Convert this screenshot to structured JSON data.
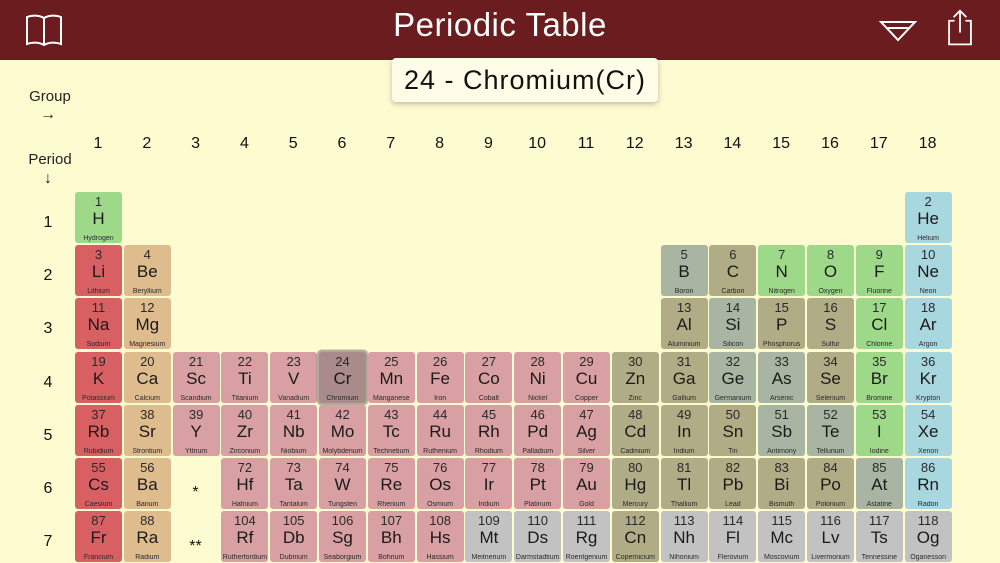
{
  "header": {
    "title": "Periodic Table"
  },
  "selected": {
    "label": "24 - Chromium(Cr)"
  },
  "axis": {
    "group_label": "Group",
    "period_label": "Period",
    "group_arrow": "→",
    "period_arrow": "↓"
  },
  "groups": [
    "1",
    "2",
    "3",
    "4",
    "5",
    "6",
    "7",
    "8",
    "9",
    "10",
    "11",
    "12",
    "13",
    "14",
    "15",
    "16",
    "17",
    "18"
  ],
  "periods": [
    "1",
    "2",
    "3",
    "4",
    "5",
    "6",
    "7"
  ],
  "markers": {
    "lanthanides": "*",
    "actinides": "**"
  },
  "colors": {
    "alkali": "#d86063",
    "alkaline": "#dfbc8e",
    "transition": "#d9a0a3",
    "post": "#b0ac85",
    "metalloid": "#a8b5a3",
    "nonmetal": "#9ed98a",
    "noble": "#a9d7e0",
    "unknown": "#c2c2c2",
    "header": "#6b1c1f",
    "background": "#fdfbd0"
  },
  "elements": [
    {
      "n": "1",
      "s": "H",
      "name": "Hydrogen",
      "g": 1,
      "p": 1,
      "c": "nonmetal"
    },
    {
      "n": "2",
      "s": "He",
      "name": "Helium",
      "g": 18,
      "p": 1,
      "c": "noble"
    },
    {
      "n": "3",
      "s": "Li",
      "name": "Lithium",
      "g": 1,
      "p": 2,
      "c": "alkali"
    },
    {
      "n": "4",
      "s": "Be",
      "name": "Beryllium",
      "g": 2,
      "p": 2,
      "c": "alkaline"
    },
    {
      "n": "5",
      "s": "B",
      "name": "Boron",
      "g": 13,
      "p": 2,
      "c": "metalloid"
    },
    {
      "n": "6",
      "s": "C",
      "name": "Carbon",
      "g": 14,
      "p": 2,
      "c": "post"
    },
    {
      "n": "7",
      "s": "N",
      "name": "Nitrogen",
      "g": 15,
      "p": 2,
      "c": "nonmetal"
    },
    {
      "n": "8",
      "s": "O",
      "name": "Oxygen",
      "g": 16,
      "p": 2,
      "c": "nonmetal"
    },
    {
      "n": "9",
      "s": "F",
      "name": "Fluorine",
      "g": 17,
      "p": 2,
      "c": "nonmetal"
    },
    {
      "n": "10",
      "s": "Ne",
      "name": "Neon",
      "g": 18,
      "p": 2,
      "c": "noble"
    },
    {
      "n": "11",
      "s": "Na",
      "name": "Sodium",
      "g": 1,
      "p": 3,
      "c": "alkali"
    },
    {
      "n": "12",
      "s": "Mg",
      "name": "Magnesium",
      "g": 2,
      "p": 3,
      "c": "alkaline"
    },
    {
      "n": "13",
      "s": "Al",
      "name": "Aluminium",
      "g": 13,
      "p": 3,
      "c": "post"
    },
    {
      "n": "14",
      "s": "Si",
      "name": "Silicon",
      "g": 14,
      "p": 3,
      "c": "metalloid"
    },
    {
      "n": "15",
      "s": "P",
      "name": "Phosphorus",
      "g": 15,
      "p": 3,
      "c": "post"
    },
    {
      "n": "16",
      "s": "S",
      "name": "Sulfur",
      "g": 16,
      "p": 3,
      "c": "post"
    },
    {
      "n": "17",
      "s": "Cl",
      "name": "Chlorine",
      "g": 17,
      "p": 3,
      "c": "nonmetal"
    },
    {
      "n": "18",
      "s": "Ar",
      "name": "Argon",
      "g": 18,
      "p": 3,
      "c": "noble"
    },
    {
      "n": "19",
      "s": "K",
      "name": "Potassium",
      "g": 1,
      "p": 4,
      "c": "alkali"
    },
    {
      "n": "20",
      "s": "Ca",
      "name": "Calcium",
      "g": 2,
      "p": 4,
      "c": "alkaline"
    },
    {
      "n": "21",
      "s": "Sc",
      "name": "Scandium",
      "g": 3,
      "p": 4,
      "c": "transition"
    },
    {
      "n": "22",
      "s": "Ti",
      "name": "Titanium",
      "g": 4,
      "p": 4,
      "c": "transition"
    },
    {
      "n": "23",
      "s": "V",
      "name": "Vanadium",
      "g": 5,
      "p": 4,
      "c": "transition"
    },
    {
      "n": "24",
      "s": "Cr",
      "name": "Chromium",
      "g": 6,
      "p": 4,
      "c": "transition",
      "selected": true
    },
    {
      "n": "25",
      "s": "Mn",
      "name": "Manganese",
      "g": 7,
      "p": 4,
      "c": "transition"
    },
    {
      "n": "26",
      "s": "Fe",
      "name": "Iron",
      "g": 8,
      "p": 4,
      "c": "transition"
    },
    {
      "n": "27",
      "s": "Co",
      "name": "Cobalt",
      "g": 9,
      "p": 4,
      "c": "transition"
    },
    {
      "n": "28",
      "s": "Ni",
      "name": "Nickel",
      "g": 10,
      "p": 4,
      "c": "transition"
    },
    {
      "n": "29",
      "s": "Cu",
      "name": "Copper",
      "g": 11,
      "p": 4,
      "c": "transition"
    },
    {
      "n": "30",
      "s": "Zn",
      "name": "Zinc",
      "g": 12,
      "p": 4,
      "c": "post"
    },
    {
      "n": "31",
      "s": "Ga",
      "name": "Gallium",
      "g": 13,
      "p": 4,
      "c": "post"
    },
    {
      "n": "32",
      "s": "Ge",
      "name": "Germanium",
      "g": 14,
      "p": 4,
      "c": "metalloid"
    },
    {
      "n": "33",
      "s": "As",
      "name": "Arsenic",
      "g": 15,
      "p": 4,
      "c": "metalloid"
    },
    {
      "n": "34",
      "s": "Se",
      "name": "Selenium",
      "g": 16,
      "p": 4,
      "c": "post"
    },
    {
      "n": "35",
      "s": "Br",
      "name": "Bromine",
      "g": 17,
      "p": 4,
      "c": "nonmetal"
    },
    {
      "n": "36",
      "s": "Kr",
      "name": "Krypton",
      "g": 18,
      "p": 4,
      "c": "noble"
    },
    {
      "n": "37",
      "s": "Rb",
      "name": "Rubidium",
      "g": 1,
      "p": 5,
      "c": "alkali"
    },
    {
      "n": "38",
      "s": "Sr",
      "name": "Strontium",
      "g": 2,
      "p": 5,
      "c": "alkaline"
    },
    {
      "n": "39",
      "s": "Y",
      "name": "Yttrium",
      "g": 3,
      "p": 5,
      "c": "transition"
    },
    {
      "n": "40",
      "s": "Zr",
      "name": "Zirconium",
      "g": 4,
      "p": 5,
      "c": "transition"
    },
    {
      "n": "41",
      "s": "Nb",
      "name": "Niobium",
      "g": 5,
      "p": 5,
      "c": "transition"
    },
    {
      "n": "42",
      "s": "Mo",
      "name": "Molybdenum",
      "g": 6,
      "p": 5,
      "c": "transition"
    },
    {
      "n": "43",
      "s": "Tc",
      "name": "Technetium",
      "g": 7,
      "p": 5,
      "c": "transition"
    },
    {
      "n": "44",
      "s": "Ru",
      "name": "Ruthenium",
      "g": 8,
      "p": 5,
      "c": "transition"
    },
    {
      "n": "45",
      "s": "Rh",
      "name": "Rhodium",
      "g": 9,
      "p": 5,
      "c": "transition"
    },
    {
      "n": "46",
      "s": "Pd",
      "name": "Palladium",
      "g": 10,
      "p": 5,
      "c": "transition"
    },
    {
      "n": "47",
      "s": "Ag",
      "name": "Silver",
      "g": 11,
      "p": 5,
      "c": "transition"
    },
    {
      "n": "48",
      "s": "Cd",
      "name": "Cadmium",
      "g": 12,
      "p": 5,
      "c": "post"
    },
    {
      "n": "49",
      "s": "In",
      "name": "Indium",
      "g": 13,
      "p": 5,
      "c": "post"
    },
    {
      "n": "50",
      "s": "Sn",
      "name": "Tin",
      "g": 14,
      "p": 5,
      "c": "post"
    },
    {
      "n": "51",
      "s": "Sb",
      "name": "Antimony",
      "g": 15,
      "p": 5,
      "c": "metalloid"
    },
    {
      "n": "52",
      "s": "Te",
      "name": "Tellurium",
      "g": 16,
      "p": 5,
      "c": "metalloid"
    },
    {
      "n": "53",
      "s": "I",
      "name": "Iodine",
      "g": 17,
      "p": 5,
      "c": "nonmetal"
    },
    {
      "n": "54",
      "s": "Xe",
      "name": "Xenon",
      "g": 18,
      "p": 5,
      "c": "noble"
    },
    {
      "n": "55",
      "s": "Cs",
      "name": "Caesium",
      "g": 1,
      "p": 6,
      "c": "alkali"
    },
    {
      "n": "56",
      "s": "Ba",
      "name": "Barium",
      "g": 2,
      "p": 6,
      "c": "alkaline"
    },
    {
      "n": "72",
      "s": "Hf",
      "name": "Hafnium",
      "g": 4,
      "p": 6,
      "c": "transition"
    },
    {
      "n": "73",
      "s": "Ta",
      "name": "Tantalum",
      "g": 5,
      "p": 6,
      "c": "transition"
    },
    {
      "n": "74",
      "s": "W",
      "name": "Tungsten",
      "g": 6,
      "p": 6,
      "c": "transition"
    },
    {
      "n": "75",
      "s": "Re",
      "name": "Rhenium",
      "g": 7,
      "p": 6,
      "c": "transition"
    },
    {
      "n": "76",
      "s": "Os",
      "name": "Osmium",
      "g": 8,
      "p": 6,
      "c": "transition"
    },
    {
      "n": "77",
      "s": "Ir",
      "name": "Iridium",
      "g": 9,
      "p": 6,
      "c": "transition"
    },
    {
      "n": "78",
      "s": "Pt",
      "name": "Platinum",
      "g": 10,
      "p": 6,
      "c": "transition"
    },
    {
      "n": "79",
      "s": "Au",
      "name": "Gold",
      "g": 11,
      "p": 6,
      "c": "transition"
    },
    {
      "n": "80",
      "s": "Hg",
      "name": "Mercury",
      "g": 12,
      "p": 6,
      "c": "post"
    },
    {
      "n": "81",
      "s": "Tl",
      "name": "Thallium",
      "g": 13,
      "p": 6,
      "c": "post"
    },
    {
      "n": "82",
      "s": "Pb",
      "name": "Lead",
      "g": 14,
      "p": 6,
      "c": "post"
    },
    {
      "n": "83",
      "s": "Bi",
      "name": "Bismuth",
      "g": 15,
      "p": 6,
      "c": "post"
    },
    {
      "n": "84",
      "s": "Po",
      "name": "Polonium",
      "g": 16,
      "p": 6,
      "c": "post"
    },
    {
      "n": "85",
      "s": "At",
      "name": "Astatine",
      "g": 17,
      "p": 6,
      "c": "metalloid"
    },
    {
      "n": "86",
      "s": "Rn",
      "name": "Radon",
      "g": 18,
      "p": 6,
      "c": "noble"
    },
    {
      "n": "87",
      "s": "Fr",
      "name": "Francium",
      "g": 1,
      "p": 7,
      "c": "alkali"
    },
    {
      "n": "88",
      "s": "Ra",
      "name": "Radium",
      "g": 2,
      "p": 7,
      "c": "alkaline"
    },
    {
      "n": "104",
      "s": "Rf",
      "name": "Rutherfordium",
      "g": 4,
      "p": 7,
      "c": "transition"
    },
    {
      "n": "105",
      "s": "Db",
      "name": "Dubnium",
      "g": 5,
      "p": 7,
      "c": "transition"
    },
    {
      "n": "106",
      "s": "Sg",
      "name": "Seaborgium",
      "g": 6,
      "p": 7,
      "c": "transition"
    },
    {
      "n": "107",
      "s": "Bh",
      "name": "Bohrium",
      "g": 7,
      "p": 7,
      "c": "transition"
    },
    {
      "n": "108",
      "s": "Hs",
      "name": "Hassium",
      "g": 8,
      "p": 7,
      "c": "transition"
    },
    {
      "n": "109",
      "s": "Mt",
      "name": "Meitnerium",
      "g": 9,
      "p": 7,
      "c": "unknown"
    },
    {
      "n": "110",
      "s": "Ds",
      "name": "Darmstadtium",
      "g": 10,
      "p": 7,
      "c": "unknown"
    },
    {
      "n": "111",
      "s": "Rg",
      "name": "Roentgenium",
      "g": 11,
      "p": 7,
      "c": "unknown"
    },
    {
      "n": "112",
      "s": "Cn",
      "name": "Copernicium",
      "g": 12,
      "p": 7,
      "c": "post"
    },
    {
      "n": "113",
      "s": "Nh",
      "name": "Nihonium",
      "g": 13,
      "p": 7,
      "c": "unknown"
    },
    {
      "n": "114",
      "s": "Fl",
      "name": "Flerovium",
      "g": 14,
      "p": 7,
      "c": "unknown"
    },
    {
      "n": "115",
      "s": "Mc",
      "name": "Moscovium",
      "g": 15,
      "p": 7,
      "c": "unknown"
    },
    {
      "n": "116",
      "s": "Lv",
      "name": "Livermorium",
      "g": 16,
      "p": 7,
      "c": "unknown"
    },
    {
      "n": "117",
      "s": "Ts",
      "name": "Tennessine",
      "g": 17,
      "p": 7,
      "c": "unknown"
    },
    {
      "n": "118",
      "s": "Og",
      "name": "Oganesson",
      "g": 18,
      "p": 7,
      "c": "unknown"
    }
  ]
}
